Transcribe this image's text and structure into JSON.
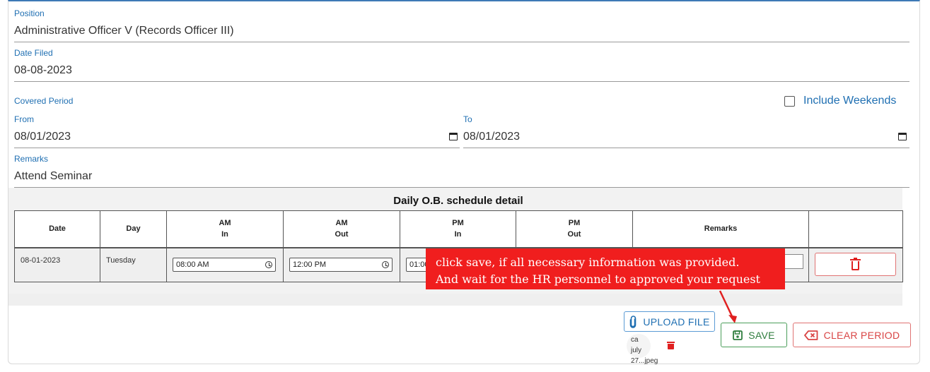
{
  "form": {
    "position": {
      "label": "Position",
      "value": "Administrative Officer V (Records Officer III)"
    },
    "date_filed": {
      "label": "Date Filed",
      "value": "08-08-2023"
    },
    "covered_period": {
      "label": "Covered Period"
    },
    "include_weekends": {
      "label": "Include Weekends",
      "checked": false
    },
    "from": {
      "label": "From",
      "value": "08/01/2023"
    },
    "to": {
      "label": "To",
      "value": "08/01/2023"
    },
    "remarks": {
      "label": "Remarks",
      "value": "Attend Seminar"
    }
  },
  "schedule": {
    "title": "Daily O.B. schedule detail",
    "headers": {
      "date": "Date",
      "day": "Day",
      "am": "AM",
      "pm": "PM",
      "in": "In",
      "out": "Out",
      "remarks": "Remarks"
    },
    "rows": [
      {
        "date": "08-01-2023",
        "day": "Tuesday",
        "am_in": "08:00 AM",
        "am_out": "12:00 PM",
        "pm_in": "01:00"
      }
    ]
  },
  "tooltip": {
    "line1": "click save, if all necessary information was provided.",
    "line2": "And wait for the HR personnel to approved your request"
  },
  "actions": {
    "upload_label": "UPLOAD FILE",
    "save_label": "SAVE",
    "clear_label": "CLEAR PERIOD"
  },
  "attachment": {
    "line1": "ca july",
    "line2": "27...jpeg"
  },
  "colors": {
    "label_blue": "#1f6fb2",
    "danger_red": "#e02020",
    "tooltip_red": "#f01e1e",
    "save_green": "#2f7d3e"
  }
}
